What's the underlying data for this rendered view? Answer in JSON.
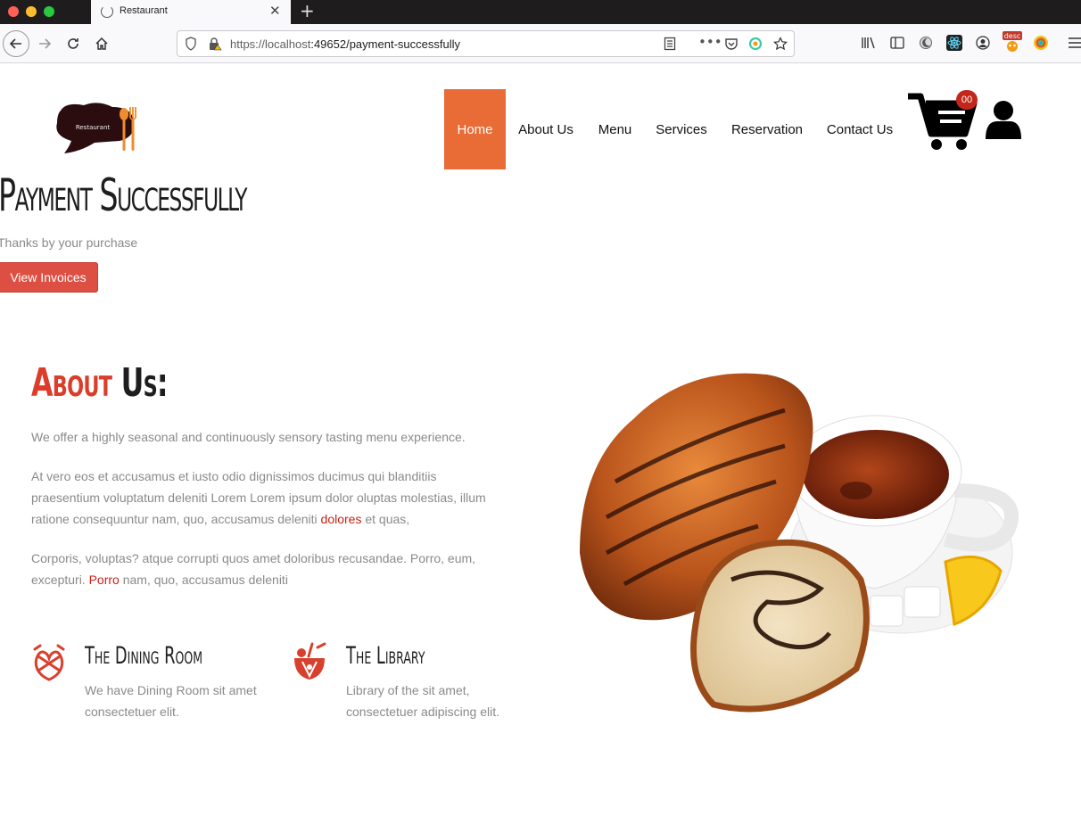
{
  "browser": {
    "tab_title": "Restaurant",
    "url_host": "https://localhost",
    "url_path": ":49652/payment-successfully",
    "ext_badge": "desc"
  },
  "nav": {
    "items": [
      {
        "label": "Home",
        "active": true
      },
      {
        "label": "About Us"
      },
      {
        "label": "Menu"
      },
      {
        "label": "Services"
      },
      {
        "label": "Reservation"
      },
      {
        "label": "Contact Us"
      }
    ],
    "cart_count": "00",
    "logo_text": "Restaurant"
  },
  "hero": {
    "title": "Payment Successfully",
    "subtitle": "Thanks by your purchase",
    "button": "View Invoices"
  },
  "about": {
    "title_part1": "About",
    "title_part2": " Us:",
    "p1": "We offer a highly seasonal and continuously sensory tasting menu experience.",
    "p2_line1": "At vero eos et accusamus et iusto odio dignissimos ducimus qui blanditiis",
    "p2_line2": "praesentium voluptatum deleniti Lorem Lorem ipsum dolor oluptas molestias, illum",
    "p2_line3_a": "ratione consequuntur nam, quo, accusamus deleniti ",
    "p2_line3_link": "dolores",
    "p2_line3_b": " et quas,",
    "p3_line1": "Corporis, voluptas? atque corrupti quos amet doloribus recusandae. Porro, eum,",
    "p3_line2_a": "excepturi. ",
    "p3_line2_link": "Porro",
    "p3_line2_b": " nam, quo, accusamus deleniti"
  },
  "features": [
    {
      "title": "The Dining Room",
      "text_line1": "We have Dining Room sit amet",
      "text_line2": "consectetuer elit.",
      "icon": "pretzel-icon"
    },
    {
      "title": "The Library",
      "text_line1": "Library of the sit amet,",
      "text_line2": "consectetuer adipiscing elit.",
      "icon": "cocktail-icon"
    }
  ],
  "colors": {
    "accent": "#e96b36",
    "button": "#de4f43",
    "link": "#cc1f14",
    "badge": "#c1271b"
  }
}
